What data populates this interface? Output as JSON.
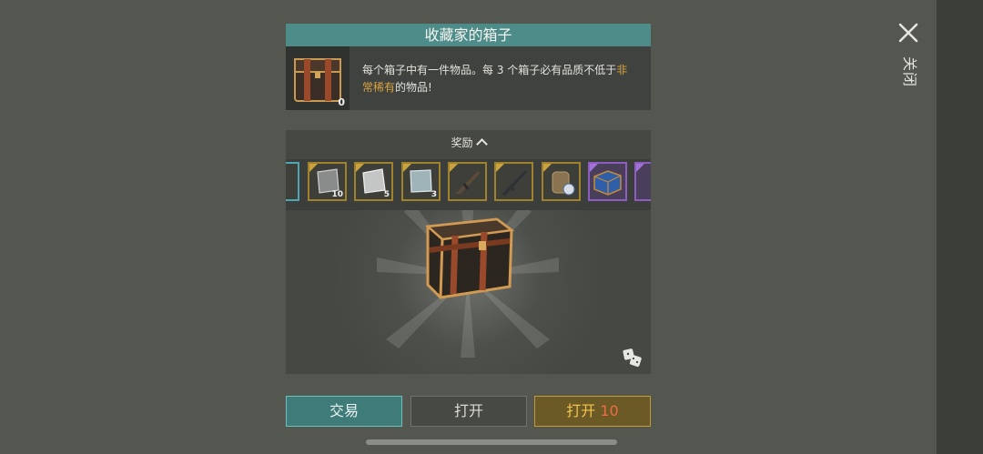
{
  "close": {
    "label": "关闭",
    "icon": "close-icon"
  },
  "box": {
    "title": "收藏家的箱子",
    "count": "0",
    "description_before": "每个箱子中有一件物品。每 3 个箱子必有品质不低于",
    "description_highlight": "非常稀有",
    "description_after": "的物品!",
    "highlight_color": "#d9a340"
  },
  "rewards": {
    "title": "奖励",
    "items": [
      {
        "name": "partial-item",
        "count": ""
      },
      {
        "name": "metal-plate-item",
        "count": "10"
      },
      {
        "name": "steel-plate-item",
        "count": "5"
      },
      {
        "name": "titanium-plate-item",
        "count": "3"
      },
      {
        "name": "assault-rifle-item",
        "count": ""
      },
      {
        "name": "rifle-item",
        "count": ""
      },
      {
        "name": "backpack-item",
        "count": ""
      },
      {
        "name": "blue-crate-item",
        "count": ""
      },
      {
        "name": "partial-purple-item",
        "count": ""
      }
    ]
  },
  "buttons": {
    "trade": "交易",
    "open": "打开",
    "open_multi_label": "打开",
    "open_multi_count": "10"
  }
}
